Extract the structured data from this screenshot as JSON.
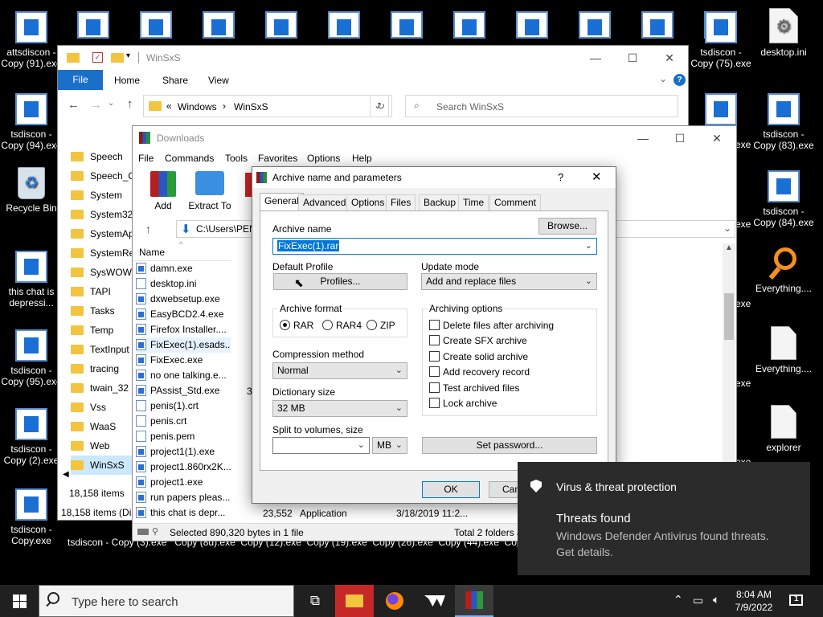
{
  "desktop": {
    "icons": [
      {
        "label": "attsdiscon - Copy (91).exe",
        "type": "exe"
      },
      {
        "label": "tsdiscon - Copy (94).exe",
        "type": "exe"
      },
      {
        "label": "Recycle Bin",
        "type": "recycle"
      },
      {
        "label": "this chat is depressi...",
        "type": "exe"
      },
      {
        "label": "tsdiscon - Copy (95).exe",
        "type": "exe"
      },
      {
        "label": "tsdiscon - Copy (2).exe",
        "type": "exe"
      },
      {
        "label": "tsdiscon - Copy.exe",
        "type": "exe"
      },
      {
        "label": "tsdiscon - Copy (75).exe",
        "type": "exe"
      },
      {
        "label": "desktop.ini",
        "type": "gear"
      },
      {
        "label": "tsdiscon - Copy (83).exe",
        "type": "exe"
      },
      {
        "label": "tsdiscon - Copy (84).exe",
        "type": "exe"
      },
      {
        "label": "Everything....",
        "type": "search"
      },
      {
        "label": "Everything....",
        "type": "file"
      },
      {
        "label": "explorer",
        "type": "file"
      }
    ],
    "bottom_labels": "tsdiscon - Copy (3).exe   Copy (8d).exe  Copy (12).exe  Copy (19).exe  Copy (26).exe  Copy (44).exe  Copy (51).exe  Copy (6).exe",
    "side_labels": [
      "exe",
      "exe",
      "exe",
      "exe",
      "exe"
    ]
  },
  "explorer": {
    "title": "WinSxS",
    "ribbon_tabs": [
      "File",
      "Home",
      "Share",
      "View"
    ],
    "breadcrumb": [
      "Windows",
      "WinSxS"
    ],
    "search_placeholder": "Search WinSxS",
    "folders": [
      "Speech",
      "Speech_On",
      "System",
      "System32",
      "SystemApp",
      "SystemRes",
      "SysWOW64",
      "TAPI",
      "Tasks",
      "Temp",
      "TextInput",
      "tracing",
      "twain_32",
      "Vss",
      "WaaS",
      "Web",
      "WinSxS"
    ],
    "items_count": "18,158 items",
    "status_text": "18,158 items (Dis"
  },
  "winrar": {
    "title": "Downloads",
    "menu": [
      "File",
      "Commands",
      "Tools",
      "Favorites",
      "Options",
      "Help"
    ],
    "toolbar": [
      "Add",
      "Extract To"
    ],
    "path": "C:\\Users\\PEN",
    "column_name": "Name",
    "files": [
      {
        "name": "damn.exe",
        "icon": "exe"
      },
      {
        "name": "desktop.ini",
        "icon": "ini"
      },
      {
        "name": "dxwebsetup.exe",
        "icon": "exe"
      },
      {
        "name": "EasyBCD2.4.exe",
        "icon": "exe"
      },
      {
        "name": "Firefox Installer....",
        "icon": "exe"
      },
      {
        "name": "FixExec(1).esads...",
        "icon": "exe"
      },
      {
        "name": "FixExec.exe",
        "icon": "exe"
      },
      {
        "name": "no one talking.e...",
        "icon": "exe"
      },
      {
        "name": "PAssist_Std.exe",
        "icon": "exe"
      },
      {
        "name": "penis(1).crt",
        "icon": "cert"
      },
      {
        "name": "penis.crt",
        "icon": "cert"
      },
      {
        "name": "penis.pem",
        "icon": "ini"
      },
      {
        "name": "project1(1).exe",
        "icon": "exe"
      },
      {
        "name": "project1.860rx2K...",
        "icon": "exe"
      },
      {
        "name": "project1.exe",
        "icon": "exe"
      },
      {
        "name": "run papers pleas...",
        "icon": "exe"
      },
      {
        "name": "this chat is depr...",
        "icon": "exe"
      }
    ],
    "partial_size": "3",
    "last_row": {
      "size": "23,552",
      "type": "Application",
      "date": "3/18/2019 11:2..."
    },
    "status_left": "Selected 890,320 bytes in 1 file",
    "status_right": "Total 2 folders a"
  },
  "dialog": {
    "title": "Archive name and parameters",
    "help": "?",
    "tabs": [
      "General",
      "Advanced",
      "Options",
      "Files",
      "Backup",
      "Time",
      "Comment"
    ],
    "archive_name_label": "Archive name",
    "archive_name_value": "FixExec(1).rar",
    "browse": "Browse...",
    "default_profile_label": "Default Profile",
    "profiles": "Profiles...",
    "update_mode_label": "Update mode",
    "update_mode_value": "Add and replace files",
    "archive_format_label": "Archive format",
    "formats": [
      "RAR",
      "RAR4",
      "ZIP"
    ],
    "compression_label": "Compression method",
    "compression_value": "Normal",
    "dict_label": "Dictionary size",
    "dict_value": "32 MB",
    "split_label": "Split to volumes, size",
    "split_unit": "MB",
    "archiving_options_label": "Archiving options",
    "options": [
      "Delete files after archiving",
      "Create SFX archive",
      "Create solid archive",
      "Add recovery record",
      "Test archived files",
      "Lock archive"
    ],
    "set_password": "Set password...",
    "ok": "OK",
    "cancel": "Can"
  },
  "toast": {
    "app": "Virus & threat protection",
    "title": "Threats found",
    "body": "Windows Defender Antivirus found threats. Get details."
  },
  "taskbar": {
    "search_placeholder": "Type here to search",
    "time": "8:04 AM",
    "date": "7/9/2022",
    "notif_count": "1"
  }
}
